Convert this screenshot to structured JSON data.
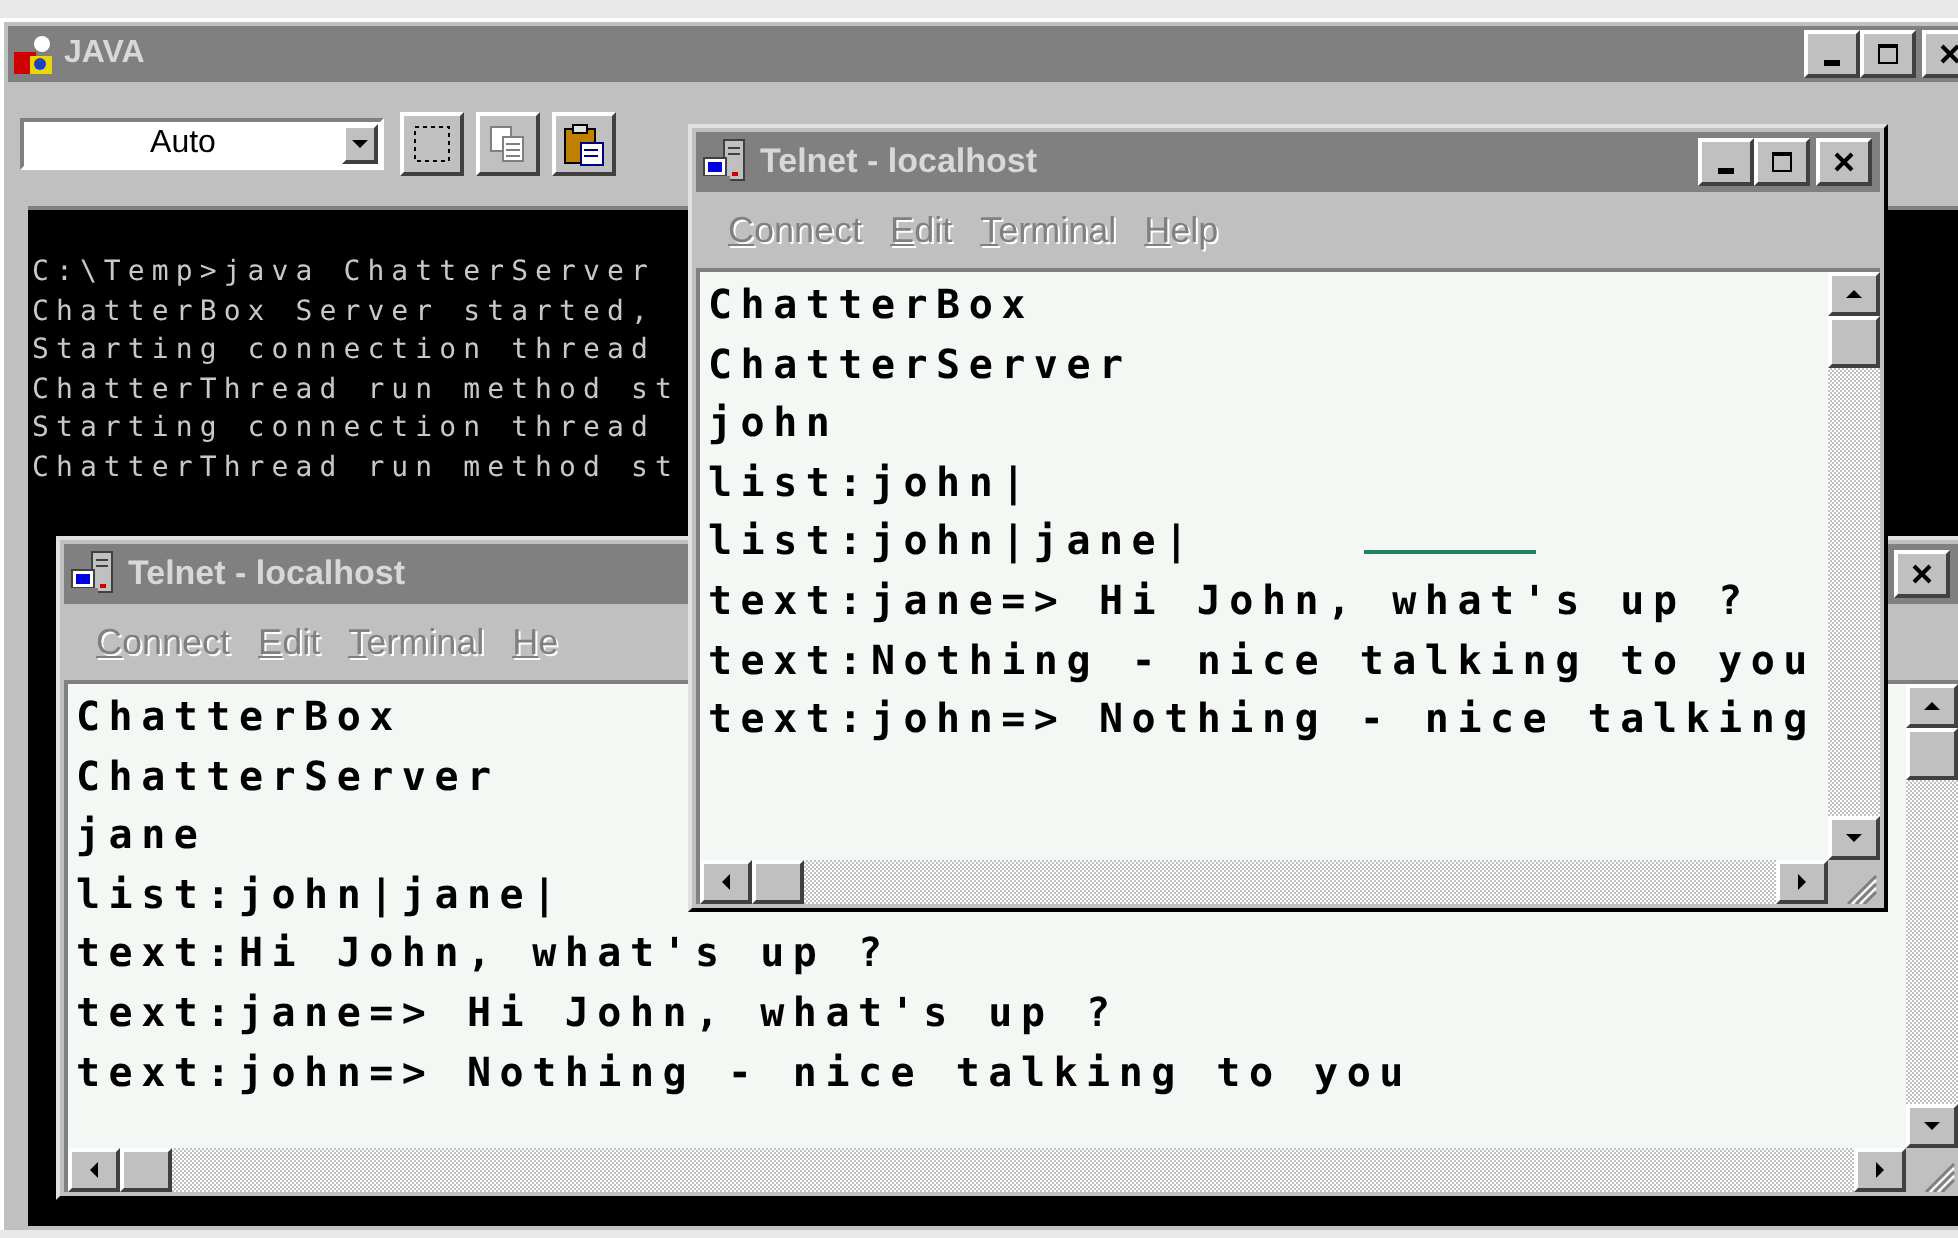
{
  "window": {
    "title": "JAVA",
    "active": false,
    "title_buttons": [
      {
        "kind": "minimize"
      },
      {
        "kind": "maximize"
      },
      {
        "kind": "close"
      }
    ]
  },
  "toolbar": {
    "font_size": {
      "value": "Auto"
    },
    "buttons": [
      {
        "kind": "mark"
      },
      {
        "kind": "copy"
      },
      {
        "kind": "paste"
      }
    ]
  },
  "console": {
    "lines": [
      "C:\\Temp>java ChatterServer",
      "ChatterBox Server started,",
      "Starting connection thread",
      "ChatterThread run method st",
      "Starting connection thread",
      "ChatterThread run method st"
    ]
  },
  "telnet_windows": [
    {
      "title": "Telnet - localhost",
      "active": false,
      "title_buttons": [
        {
          "kind": "close"
        }
      ],
      "menu": [
        {
          "label": "Connect",
          "disabled": true
        },
        {
          "label": "Edit",
          "disabled": true
        },
        {
          "label": "Terminal",
          "disabled": true
        },
        {
          "label": "He",
          "disabled": true
        }
      ],
      "lines": [
        "ChatterBox",
        "ChatterServer",
        "jane",
        "list:john|jane|",
        "text:Hi John, what's up ?",
        "text:jane=> Hi John, what's up ?",
        "text:john=> Nothing - nice talking to you"
      ]
    },
    {
      "title": "Telnet - localhost",
      "active": false,
      "title_buttons": [
        {
          "kind": "minimize"
        },
        {
          "kind": "maximize"
        },
        {
          "kind": "close"
        }
      ],
      "menu": [
        {
          "label": "Connect",
          "disabled": true
        },
        {
          "label": "Edit",
          "disabled": true
        },
        {
          "label": "Terminal",
          "disabled": true
        },
        {
          "label": "Help",
          "disabled": true
        }
      ],
      "lines": [
        "ChatterBox",
        "ChatterServer",
        "john",
        "list:john|",
        "list:john|jane|",
        "text:jane=> Hi John, what's up ?",
        "text:Nothing - nice talking to you",
        "text:john=> Nothing - nice talking"
      ]
    }
  ]
}
